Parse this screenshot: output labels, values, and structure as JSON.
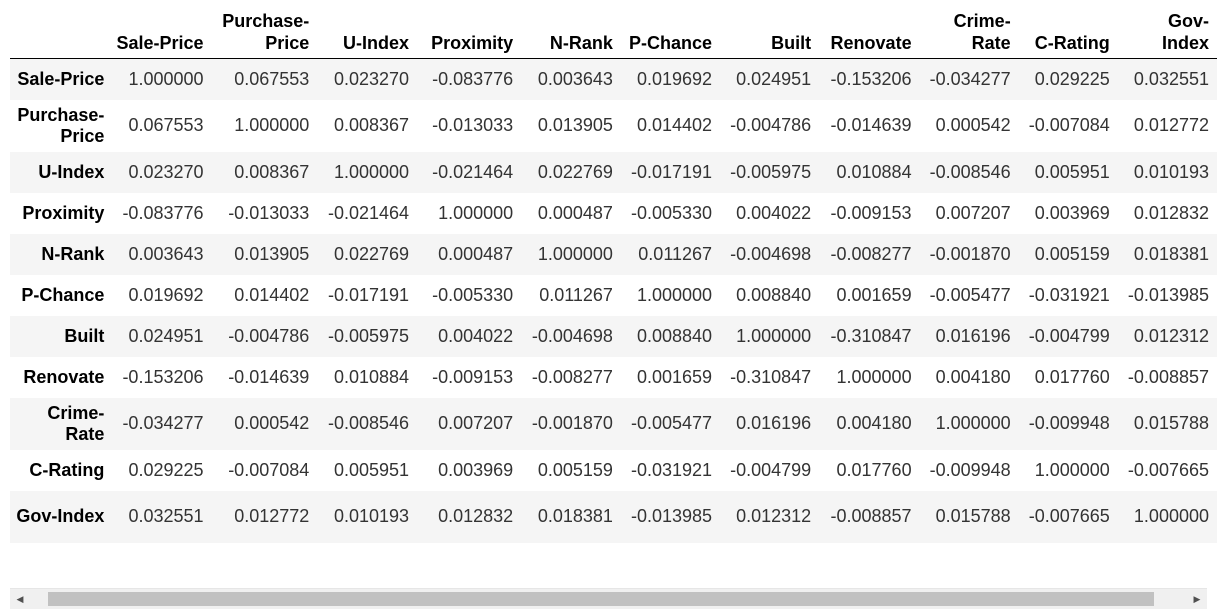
{
  "table": {
    "columns": [
      "Sale-Price",
      "Purchase-Price",
      "U-Index",
      "Proximity",
      "N-Rank",
      "P-Chance",
      "Built",
      "Renovate",
      "Crime-Rate",
      "C-Rating",
      "Gov-Index"
    ],
    "rows": [
      {
        "label": "Sale-Price",
        "values": [
          "1.000000",
          "0.067553",
          "0.023270",
          "-0.083776",
          "0.003643",
          "0.019692",
          "0.024951",
          "-0.153206",
          "-0.034277",
          "0.029225",
          "0.032551"
        ]
      },
      {
        "label": "Purchase-Price",
        "values": [
          "0.067553",
          "1.000000",
          "0.008367",
          "-0.013033",
          "0.013905",
          "0.014402",
          "-0.004786",
          "-0.014639",
          "0.000542",
          "-0.007084",
          "0.012772"
        ]
      },
      {
        "label": "U-Index",
        "values": [
          "0.023270",
          "0.008367",
          "1.000000",
          "-0.021464",
          "0.022769",
          "-0.017191",
          "-0.005975",
          "0.010884",
          "-0.008546",
          "0.005951",
          "0.010193"
        ]
      },
      {
        "label": "Proximity",
        "values": [
          "-0.083776",
          "-0.013033",
          "-0.021464",
          "1.000000",
          "0.000487",
          "-0.005330",
          "0.004022",
          "-0.009153",
          "0.007207",
          "0.003969",
          "0.012832"
        ]
      },
      {
        "label": "N-Rank",
        "values": [
          "0.003643",
          "0.013905",
          "0.022769",
          "0.000487",
          "1.000000",
          "0.011267",
          "-0.004698",
          "-0.008277",
          "-0.001870",
          "0.005159",
          "0.018381"
        ]
      },
      {
        "label": "P-Chance",
        "values": [
          "0.019692",
          "0.014402",
          "-0.017191",
          "-0.005330",
          "0.011267",
          "1.000000",
          "0.008840",
          "0.001659",
          "-0.005477",
          "-0.031921",
          "-0.013985"
        ]
      },
      {
        "label": "Built",
        "values": [
          "0.024951",
          "-0.004786",
          "-0.005975",
          "0.004022",
          "-0.004698",
          "0.008840",
          "1.000000",
          "-0.310847",
          "0.016196",
          "-0.004799",
          "0.012312"
        ]
      },
      {
        "label": "Renovate",
        "values": [
          "-0.153206",
          "-0.014639",
          "0.010884",
          "-0.009153",
          "-0.008277",
          "0.001659",
          "-0.310847",
          "1.000000",
          "0.004180",
          "0.017760",
          "-0.008857"
        ]
      },
      {
        "label": "Crime-Rate",
        "values": [
          "-0.034277",
          "0.000542",
          "-0.008546",
          "0.007207",
          "-0.001870",
          "-0.005477",
          "0.016196",
          "0.004180",
          "1.000000",
          "-0.009948",
          "0.015788"
        ]
      },
      {
        "label": "C-Rating",
        "values": [
          "0.029225",
          "-0.007084",
          "0.005951",
          "0.003969",
          "0.005159",
          "-0.031921",
          "-0.004799",
          "0.017760",
          "-0.009948",
          "1.000000",
          "-0.007665"
        ]
      },
      {
        "label": "Gov-Index",
        "values": [
          "0.032551",
          "0.012772",
          "0.010193",
          "0.012832",
          "0.018381",
          "-0.013985",
          "0.012312",
          "-0.008857",
          "0.015788",
          "-0.007665",
          "1.000000"
        ]
      }
    ]
  },
  "scrollbar": {
    "left_arrow_icon": "triangle-left-icon",
    "right_arrow_icon": "triangle-right-icon"
  }
}
